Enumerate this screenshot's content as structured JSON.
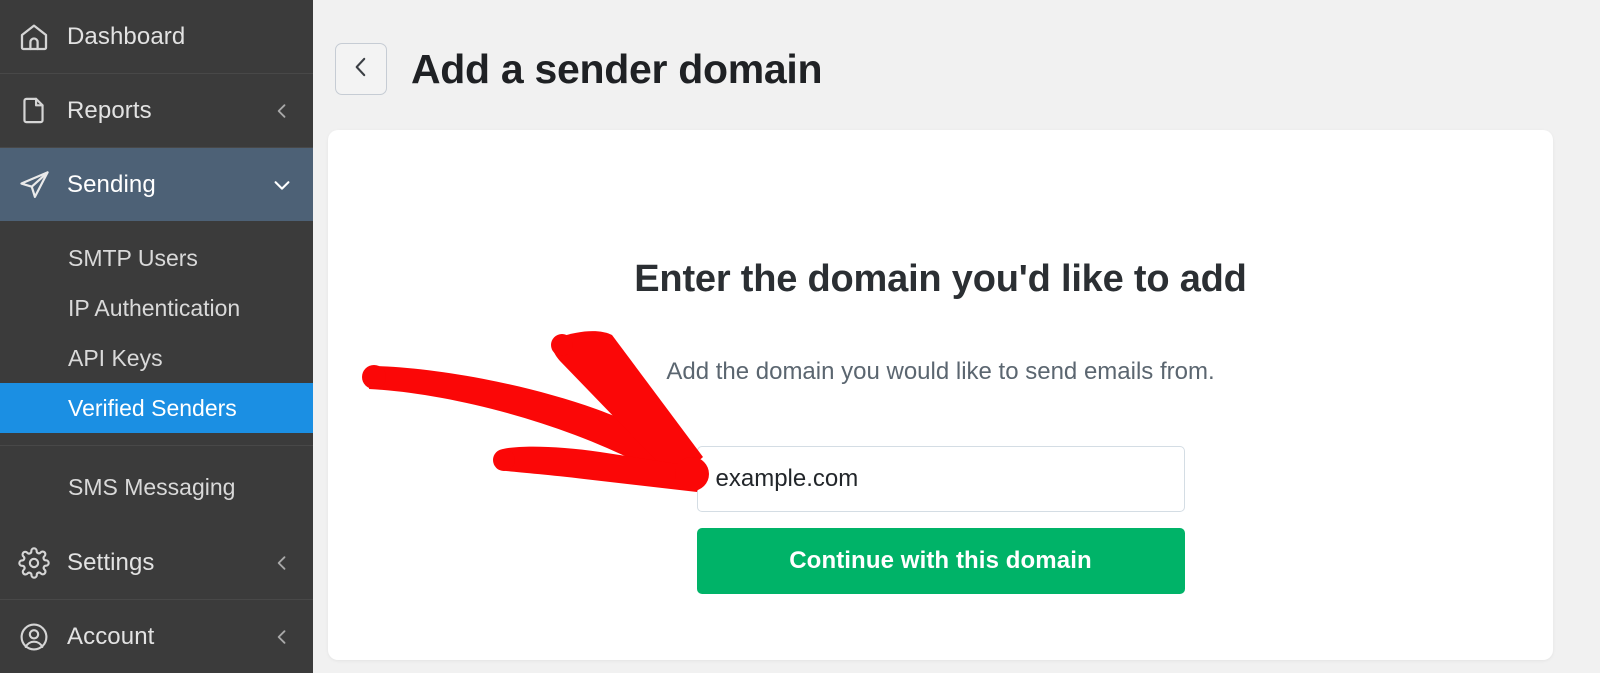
{
  "sidebar": {
    "items": [
      {
        "label": "Dashboard",
        "icon": "home-icon",
        "chevron": "none",
        "state": "default"
      },
      {
        "label": "Reports",
        "icon": "document-icon",
        "chevron": "left",
        "state": "default"
      },
      {
        "label": "Sending",
        "icon": "paper-plane-icon",
        "chevron": "down",
        "state": "selected"
      }
    ],
    "sending_subitems": [
      {
        "label": "SMTP Users",
        "state": "default"
      },
      {
        "label": "IP Authentication",
        "state": "default"
      },
      {
        "label": "API Keys",
        "state": "default"
      },
      {
        "label": "Verified Senders",
        "state": "active"
      }
    ],
    "sms_subitems": [
      {
        "label": "SMS Messaging",
        "state": "default"
      }
    ],
    "bottom_items": [
      {
        "label": "Settings",
        "icon": "gear-icon",
        "chevron": "left",
        "state": "default"
      },
      {
        "label": "Account",
        "icon": "user-circle-icon",
        "chevron": "left",
        "state": "default"
      }
    ],
    "colors": {
      "background": "#3b3b3b",
      "selected_section": "#4d6176",
      "active_item": "#1b8fe3",
      "text": "#e2e2e2"
    }
  },
  "header": {
    "back_icon": "chevron-left-icon",
    "title": "Add a sender domain"
  },
  "card": {
    "heading": "Enter the domain you'd like to add",
    "subheading": "Add the domain you would like to send emails from.",
    "domain_input": {
      "value": "example.com",
      "placeholder": "example.com"
    },
    "submit_label": "Continue with this domain",
    "submit_color": "#00b368"
  },
  "annotation": {
    "type": "arrow",
    "color": "#fb0707",
    "points_to": "domain-input"
  }
}
